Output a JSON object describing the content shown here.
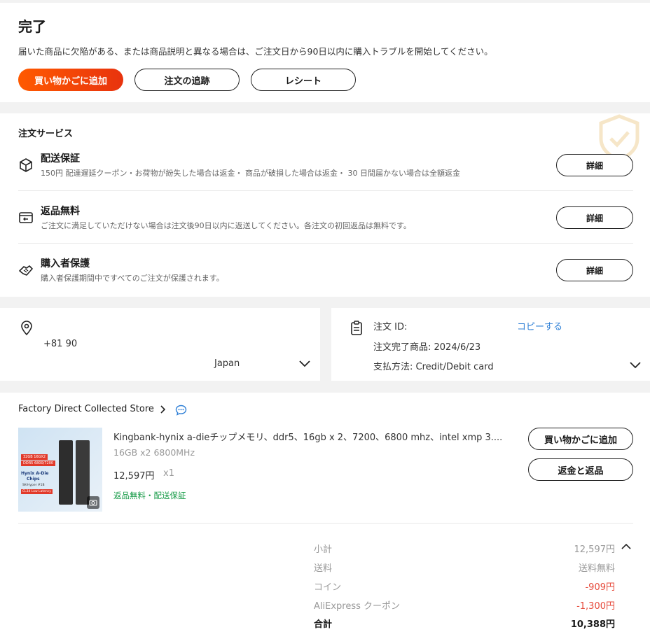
{
  "header": {
    "title": "完了",
    "message": "届いた商品に欠陥がある、または商品説明と異なる場合は、ご注文日から90日以内に購入トラブルを開始してください。",
    "buttons": {
      "add_to_cart": "買い物かごに追加",
      "track_order": "注文の追跡",
      "receipt": "レシート"
    }
  },
  "services": {
    "title": "注文サービス",
    "items": [
      {
        "title": "配送保証",
        "desc": "150円 配達遅延クーポン・お荷物が紛失した場合は返金・ 商品が破損した場合は返金・ 30 日間届かない場合は全額返金",
        "button": "詳細",
        "icon": "box-icon"
      },
      {
        "title": "返品無料",
        "desc": "ご注文に満足していただけない場合は注文後90日以内に返送してください。各注文の初回返品は無料です。",
        "button": "詳細",
        "icon": "return-icon"
      },
      {
        "title": "購入者保護",
        "desc": "購入者保護期間中ですべてのご注文が保護されます。",
        "button": "詳細",
        "icon": "handshake-icon"
      }
    ]
  },
  "address": {
    "phone": "+81 90",
    "country": "Japan"
  },
  "order_info": {
    "order_id_label": "注文 ID:",
    "copy_link": "コピーする",
    "completed": "注文完了商品: 2024/6/23",
    "payment": "支払方法: Credit/Debit card"
  },
  "store": {
    "name": "Factory Direct Collected Store"
  },
  "product": {
    "title": "Kingbank-hynix a-dieチップメモリ、ddr5、16gb x 2、7200、6800 mhz、intel xmp 3....",
    "variant": "16GB x2 6800MHz",
    "price": "12,597円",
    "qty": "x1",
    "tags": "返品無料・配送保証",
    "thumb_text1": "32GB 16GX2",
    "thumb_text2": "DDR5 6800/7200",
    "thumb_text3": "Hynix A-Die",
    "thumb_text4": "Chips",
    "thumb_text5": "SK-Hyper #1B",
    "thumb_text6": "CL34 Low Latency",
    "buttons": {
      "add_to_cart": "買い物かごに追加",
      "refund": "返金と返品"
    }
  },
  "summary": {
    "subtotal_label": "小計",
    "subtotal": "12,597円",
    "shipping_label": "送料",
    "shipping": "送料無料",
    "coin_label": "コイン",
    "coin": "-909円",
    "coupon_label": "AliExpress クーポン",
    "coupon": "-1,300円",
    "total_label": "合計",
    "total": "10,388円"
  },
  "colors": {
    "accent": "#ff5a00",
    "link": "#2e7fd6",
    "green": "#1a9c4a",
    "red": "#e64a3b"
  }
}
